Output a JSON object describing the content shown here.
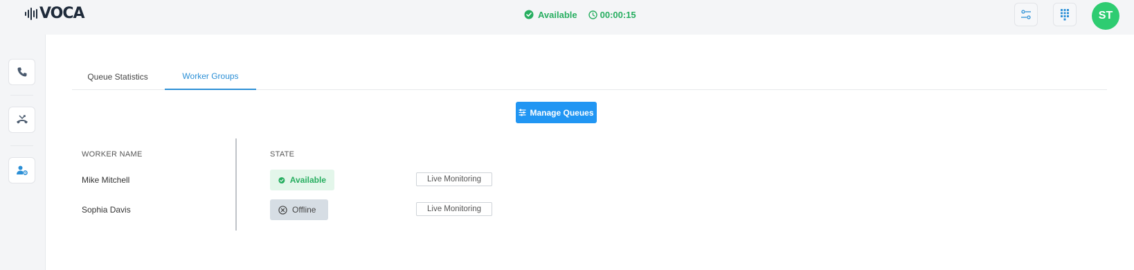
{
  "app": {
    "logo_text": "VOCA"
  },
  "header": {
    "status_label": "Available",
    "timer": "00:00:15",
    "avatar_initials": "ST"
  },
  "tabs": [
    {
      "label": "Queue Statistics",
      "active": false
    },
    {
      "label": "Worker Groups",
      "active": true
    }
  ],
  "toolbar": {
    "manage_label": "Manage Queues"
  },
  "table": {
    "columns": [
      "WORKER NAME",
      "STATE"
    ],
    "rows": [
      {
        "name": "Mike Mitchell",
        "state": "Available",
        "action": "Live Monitoring"
      },
      {
        "name": "Sophia Davis",
        "state": "Offline",
        "action": "Live Monitoring"
      }
    ]
  },
  "colors": {
    "accent": "#2196f3",
    "success": "#27ae60",
    "avatar": "#2ecc71"
  }
}
